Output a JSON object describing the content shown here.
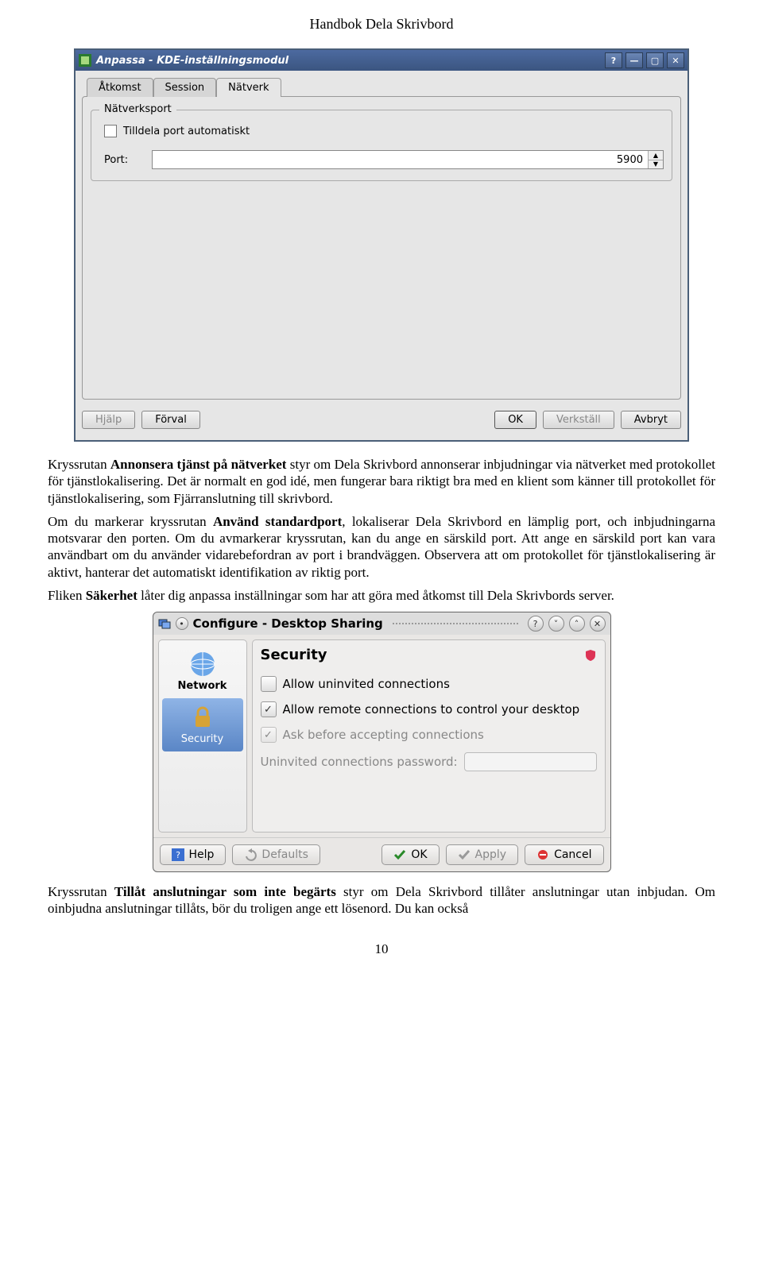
{
  "doc": {
    "header": "Handbok Dela Skrivbord",
    "page_number": "10"
  },
  "win1": {
    "title": "Anpassa - KDE-inställningsmodul",
    "tabs": {
      "access": "Åtkomst",
      "session": "Session",
      "network": "Nätverk"
    },
    "group_title": "Nätverksport",
    "checkbox_label": "Tilldela port automatiskt",
    "port_label": "Port:",
    "port_value": "5900",
    "buttons": {
      "help": "Hjälp",
      "defaults": "Förval",
      "ok": "OK",
      "apply": "Verkställ",
      "cancel": "Avbryt"
    }
  },
  "paragraphs": {
    "p1a": "Kryssrutan ",
    "p1b": "Annonsera tjänst på nätverket",
    "p1c": " styr om Dela Skrivbord annonserar inbjudningar via nätverket med protokollet för tjänstlokalisering. Det är normalt en god idé, men fungerar bara riktigt bra med en klient som känner till protokollet för tjänstlokalisering, som Fjärranslutning till skrivbord.",
    "p2a": "Om du markerar kryssrutan ",
    "p2b": "Använd standardport",
    "p2c": ", lokaliserar Dela Skrivbord en lämplig port, och inbjudningarna motsvarar den porten. Om du avmarkerar kryssrutan, kan du ange en särskild port. Att ange en särskild port kan vara användbart om du använder vidarebefordran av port i brandväggen. Observera att om protokollet för tjänstlokalisering är aktivt, hanterar det automatiskt identifikation av riktig port.",
    "p3a": "Fliken ",
    "p3b": "Säkerhet",
    "p3c": " låter dig anpassa inställningar som har att göra med åtkomst till Dela Skrivbords server.",
    "p4a": "Kryssrutan ",
    "p4b": "Tillåt anslutningar som inte begärts",
    "p4c": " styr om Dela Skrivbord tillåter anslutningar utan inbjudan. Om oinbjudna anslutningar tillåts, bör du troligen ange ett lösenord. Du kan också"
  },
  "win2": {
    "title": "Configure - Desktop Sharing",
    "sidebar": {
      "network": "Network",
      "security": "Security"
    },
    "panel_title": "Security",
    "opts": {
      "allow_uninvited": "Allow uninvited connections",
      "allow_remote_control": "Allow remote connections to control your desktop",
      "ask_before": "Ask before accepting connections",
      "password_label": "Uninvited connections password:"
    },
    "buttons": {
      "help": "Help",
      "defaults": "Defaults",
      "ok": "OK",
      "apply": "Apply",
      "cancel": "Cancel"
    }
  }
}
